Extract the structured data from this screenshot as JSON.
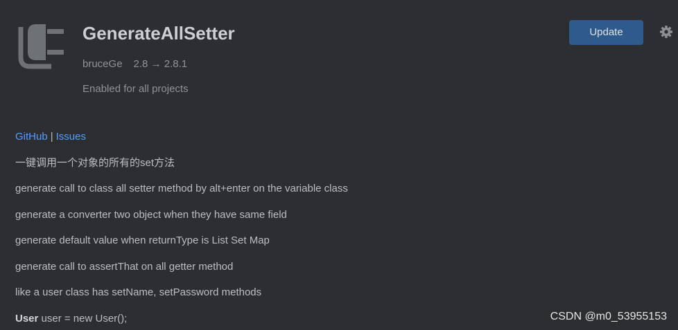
{
  "plugin": {
    "icon": "plug-icon",
    "name": "GenerateAllSetter",
    "vendor": "bruceGe",
    "version": "2.8 → 2.8.1",
    "status": "Enabled for all projects"
  },
  "actions": {
    "update_label": "Update",
    "settings_icon": "gear-icon"
  },
  "description": {
    "links": [
      {
        "label": "GitHub"
      },
      {
        "label": "Issues"
      }
    ],
    "separator": "|",
    "lines": [
      "一键调用一个对象的所有的set方法",
      "generate call to class all setter method by alt+enter on the variable class",
      "generate a converter two object when they have same field",
      "generate default value when returnType is List Set Map",
      "generate call to assertThat on all getter method",
      "like a user class has setName, setPassword methods"
    ],
    "code_line": {
      "bold": "User",
      "rest": " user = new User();"
    }
  },
  "watermark": "CSDN @m0_53955153",
  "colors": {
    "background": "#2d2e31",
    "title": "#cdcfd3",
    "muted_text": "#8f9297",
    "body_text": "#bcbec4",
    "link": "#589df6",
    "button_primary": "#2f5b8c",
    "icon": "#6e7275"
  }
}
